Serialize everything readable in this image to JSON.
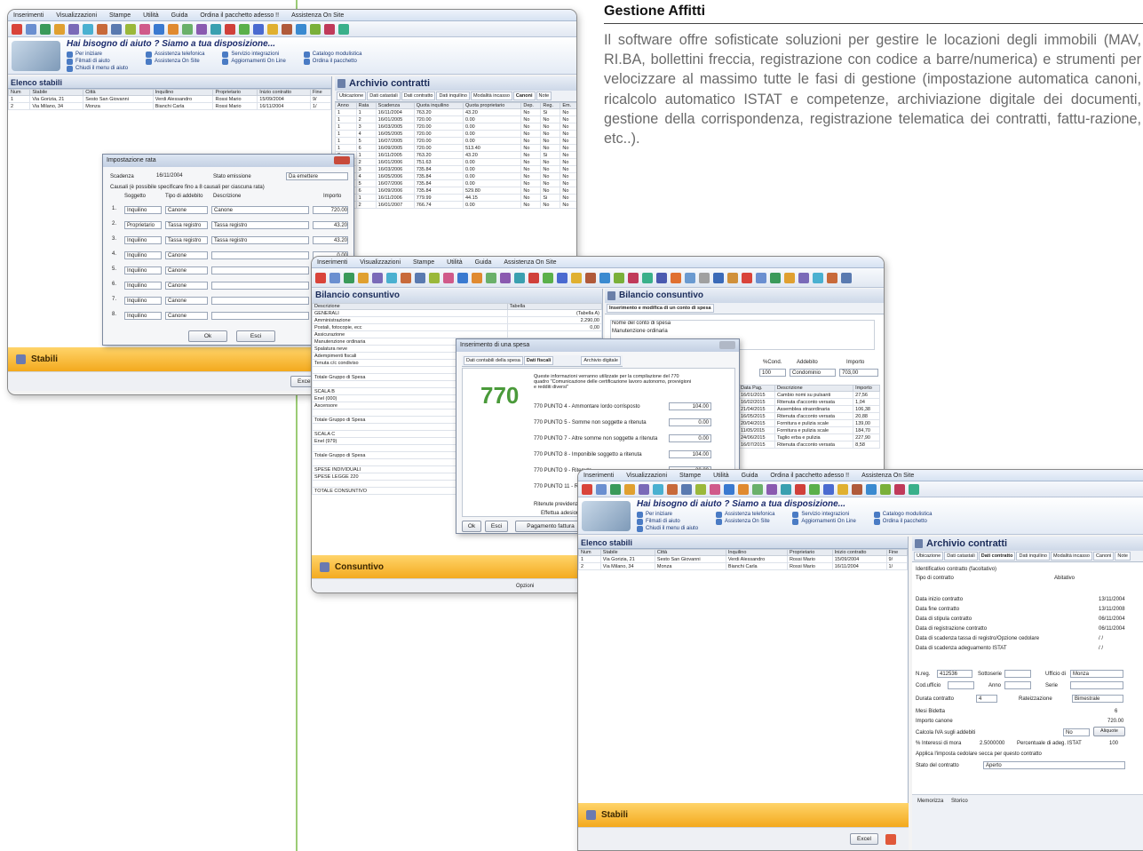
{
  "promo": {
    "title": "Gestione Affitti",
    "text": "Il software offre sofisticate soluzioni per gestire le locazioni degli immobili (MAV, RI.BA, bollettini freccia, registrazione con codice a barre/numerica) e strumenti per velocizzare al massimo tutte le fasi di gestione (impostazione automatica canoni, ricalcolo automatico ISTAT e competenze, archiviazione digitale dei documenti, gestione della corrispondenza, registrazione telematica dei contratti, fattu-razione, etc..)."
  },
  "menu": [
    "Inserimenti",
    "Visualizzazioni",
    "Stampe",
    "Utilità",
    "Guida",
    "Ordina il pacchetto adesso !!",
    "Assistenza On Site"
  ],
  "menu2": [
    "Inserimenti",
    "Visualizzazioni",
    "Stampe",
    "Utilità",
    "Guida",
    "Assistenza On Site"
  ],
  "help": {
    "headline": "Hai bisogno di aiuto ? Siamo a tua disposizione...",
    "links": [
      "Per iniziare",
      "Assistenza telefonica",
      "Servizio integrazioni",
      "Catalogo modulistica",
      "Filmati di aiuto",
      "Assistenza On Site",
      "Aggiornamenti On Line",
      "Ordina il pacchetto",
      "Chiudi il menu di aiuto"
    ]
  },
  "stabili": {
    "header": "Elenco stabili",
    "columns": [
      "Num",
      "Stabile",
      "Città",
      "Inquilino",
      "Proprietario",
      "Inizio contratto",
      "Fine"
    ],
    "rows": [
      [
        "1",
        "Via Gorizia, 21",
        "Sesto San Giovanni",
        "Verdi Alessandro",
        "Rossi Mario",
        "15/09/2004",
        "9/"
      ],
      [
        "2",
        "Via Milano, 34",
        "Monza",
        "Bianchi Carla",
        "Rossi Mario",
        "16/11/2004",
        "1/"
      ]
    ],
    "bottom": "Stabili"
  },
  "archivio": {
    "header": "Archivio contratti",
    "tabs": [
      "Ubicazione",
      "Dati catastali",
      "Dati contratto",
      "Dati inquilino",
      "Modalità incasso",
      "Canoni",
      "Note"
    ],
    "columns": [
      "Anno",
      "Rata",
      "Scadenza",
      "Quota inquilino",
      "Quota proprietario",
      "Dep.",
      "Reg.",
      "Em."
    ],
    "rows": [
      [
        "1",
        "1",
        "16/11/2004",
        "763.20",
        "43.20",
        "No",
        "Si",
        "No"
      ],
      [
        "1",
        "2",
        "16/01/2005",
        "720.00",
        "0.00",
        "No",
        "No",
        "No"
      ],
      [
        "1",
        "3",
        "16/03/2005",
        "720.00",
        "0.00",
        "No",
        "No",
        "No"
      ],
      [
        "1",
        "4",
        "16/05/2005",
        "720.00",
        "0.00",
        "No",
        "No",
        "No"
      ],
      [
        "1",
        "5",
        "16/07/2005",
        "720.00",
        "0.00",
        "No",
        "No",
        "No"
      ],
      [
        "1",
        "6",
        "16/09/2005",
        "720.00",
        "513.40",
        "No",
        "No",
        "No"
      ],
      [
        "2",
        "1",
        "16/11/2005",
        "763.20",
        "43.20",
        "No",
        "Si",
        "No"
      ],
      [
        "2",
        "2",
        "16/01/2006",
        "751.63",
        "0.00",
        "No",
        "No",
        "No"
      ],
      [
        "2",
        "3",
        "16/03/2006",
        "735.84",
        "0.00",
        "No",
        "No",
        "No"
      ],
      [
        "2",
        "4",
        "16/05/2006",
        "735.84",
        "0.00",
        "No",
        "No",
        "No"
      ],
      [
        "2",
        "5",
        "16/07/2006",
        "735.84",
        "0.00",
        "No",
        "No",
        "No"
      ],
      [
        "2",
        "6",
        "16/09/2006",
        "735.84",
        "529.80",
        "No",
        "No",
        "No"
      ],
      [
        "3",
        "1",
        "16/11/2006",
        "779.99",
        "44.15",
        "No",
        "Si",
        "No"
      ],
      [
        "3",
        "2",
        "16/01/2007",
        "766.74",
        "0.00",
        "No",
        "No",
        "No"
      ]
    ]
  },
  "rata": {
    "title": "Impostazione rata",
    "scadenza_label": "Scadenza",
    "scadenza": "16/11/2004",
    "stato_label": "Stato emissione",
    "stato": "Da emettere",
    "note": "Causali (è possibile specificare fino a 8 causali per ciascuna rata)",
    "cols": [
      "Soggetto",
      "Tipo di addebito",
      "Descrizione",
      "Importo"
    ],
    "rows": [
      [
        "1.",
        "Inquilino",
        "Canone",
        "Canone",
        "720.00"
      ],
      [
        "2.",
        "Proprietario",
        "Tassa registro",
        "Tassa registro",
        "43.20"
      ],
      [
        "3.",
        "Inquilino",
        "Tassa registro",
        "Tassa registro",
        "43.20"
      ],
      [
        "4.",
        "Inquilino",
        "Canone",
        "",
        "0.00"
      ],
      [
        "5.",
        "Inquilino",
        "Canone",
        "",
        ""
      ],
      [
        "6.",
        "Inquilino",
        "Canone",
        "",
        ""
      ],
      [
        "7.",
        "Inquilino",
        "Canone",
        "",
        ""
      ],
      [
        "8.",
        "Inquilino",
        "Canone",
        "",
        ""
      ]
    ],
    "ok": "Ok",
    "exit": "Esci"
  },
  "bilancio": {
    "header": "Bilancio consuntivo",
    "col1": "Descrizione",
    "col2": "Tabella",
    "rows": [
      [
        "GENERALI",
        "(Tabella A)"
      ],
      [
        "Amministrazione",
        "2.290,00"
      ],
      [
        "Postali, fotocopie, ecc",
        "0,00"
      ],
      [
        "Assicurazione",
        ""
      ],
      [
        "Manutenzione ordinaria",
        ""
      ],
      [
        "Spalatura neve",
        ""
      ],
      [
        "Adempimenti fiscali",
        ""
      ],
      [
        "Tenuta c/c condiviso",
        ""
      ],
      [
        "",
        ""
      ],
      [
        "Totale Gruppo di Spesa",
        ""
      ],
      [
        "",
        ""
      ],
      [
        "SCALA B",
        ""
      ],
      [
        "Enel (000)",
        ""
      ],
      [
        "Ascensore",
        ""
      ],
      [
        "",
        ""
      ],
      [
        "Totale Gruppo di Spesa",
        ""
      ],
      [
        "",
        ""
      ],
      [
        "SCALA C",
        ""
      ],
      [
        "Enel (979)",
        ""
      ],
      [
        "",
        ""
      ],
      [
        "Totale Gruppo di Spesa",
        ""
      ],
      [
        "",
        ""
      ],
      [
        "SPESE INDIVIDUALI",
        ""
      ],
      [
        "SPESE LEGGE 220",
        ""
      ],
      [
        "",
        ""
      ],
      [
        "TOTALE CONSUNTIVO",
        ""
      ]
    ],
    "bottom": "Consuntivo",
    "right_header": "Bilancio consuntivo",
    "right_tab": "Inserimento e modifica di un conto di spesa",
    "conto_label": "Nome del conto di spesa",
    "conto_value": "Manutenzione ordinaria",
    "mini_cols": [
      "%Cond.",
      "Addebito",
      "Importo"
    ],
    "mini_vals": [
      "100",
      "Condominio",
      "703,00"
    ],
    "spese_cols": [
      "Data Pag.",
      "Descrizione",
      "Importo"
    ],
    "spese_rows": [
      [
        "16/01/2015",
        "Cambio nomi su pulsanti",
        "27,56"
      ],
      [
        "16/02/2015",
        "Ritenuta d'acconto versata",
        "1,04"
      ],
      [
        "21/04/2015",
        "Assemblea straordinaria",
        "106,38"
      ],
      [
        "16/05/2015",
        "Ritenuta d'acconto versata",
        "20,88"
      ],
      [
        "20/04/2015",
        "Fornitura e pulizia scale",
        "139,00"
      ],
      [
        "11/05/2015",
        "Fornitura e pulizia scale",
        "184,70"
      ],
      [
        "24/06/2015",
        "Taglio erba e pulizia",
        "227,90"
      ],
      [
        "16/07/2015",
        "Ritenuta d'acconto versata",
        "8,58"
      ]
    ]
  },
  "spesa": {
    "title": "Inserimento di una spesa",
    "tabs": [
      "Dati contabili della spesa",
      "Dati fiscali",
      "Archivio digitale"
    ],
    "intro": "Queste informazioni verranno utilizzate per la compilazione del 770 quadro \"Comunicazione delle certificazione lavoro autonomo, provvigioni e redditi diversi\"",
    "lines": [
      [
        "770 PUNTO 4 - Ammontare lordo corrisposto",
        "104.00"
      ],
      [
        "770 PUNTO 5 - Somme non soggette a ritenuta",
        "0.00"
      ],
      [
        "770 PUNTO 7 - Altre somme non soggette a ritenuta",
        "0.00"
      ],
      [
        "770 PUNTO 8 - Imponibile soggetto a ritenuta",
        "104.00"
      ],
      [
        "770 PUNTO 9 - Ritenute",
        "20.80"
      ],
      [
        "770 PUNTO 11 - Rimborsi",
        "0.00"
      ]
    ],
    "previd": "Ritenute previdenziali",
    "check": "Effettua adesione",
    "ok": "Ok",
    "exit": "Esci",
    "pay": "Pagamento fattura"
  },
  "contratto": {
    "fields": [
      [
        "Identificativo contratto (facoltativo)",
        ""
      ],
      [
        "Tipo di contratto",
        "Abitativo"
      ],
      [
        "Data inizio contratto",
        "13/11/2004"
      ],
      [
        "Data fine contratto",
        "13/11/2008"
      ],
      [
        "Data di stipula contratto",
        "06/11/2004"
      ],
      [
        "Data di registrazione contratto",
        "06/11/2004"
      ],
      [
        "Data di scadenza tassa di registro/Opzione cedolare",
        "/ /"
      ],
      [
        "Data di scadenza adeguamento ISTAT",
        "/ /"
      ]
    ],
    "nreg_label": "N.reg.",
    "nreg": "412536",
    "serie_label": "Sottoserie",
    "ufficio_label": "Ufficio di",
    "ufficio": "Monza",
    "cod_label": "Cod.ufficio",
    "anno_label": "Anno",
    "serie2_label": "Serie",
    "durata_label": "Durata contratto",
    "durata": "4",
    "rate_label": "Rateizzazione",
    "rate": "Bimestrale",
    "mesi_label": "Mesi Bidetta",
    "mesi": "6",
    "canone_label": "Importo canone",
    "canone": "720.00",
    "iva_label": "Calcola IVA sugli addebiti",
    "iva": "No",
    "aliquota": "Aliquote",
    "mora_label": "% Interessi di mora",
    "mora": "2.5000000",
    "istat_label": "Percentuale di adeg. ISTAT",
    "istat": "100",
    "check": "Applica l'imposta cedolare secca per questo contratto",
    "stato_label": "Stato del contratto",
    "stato": "Aperto",
    "footer": [
      "Memorizza",
      "Storico"
    ]
  },
  "excel": "Excel",
  "opzioni": "Opzioni"
}
